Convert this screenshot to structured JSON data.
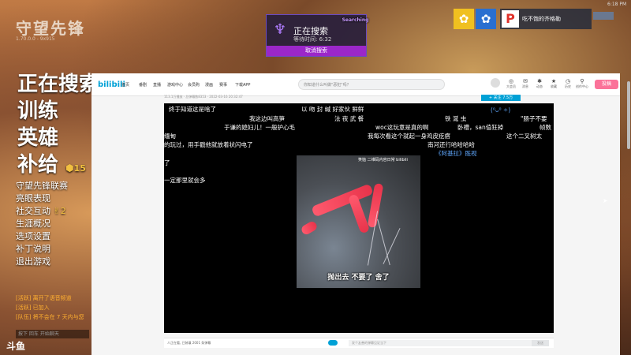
{
  "game": {
    "logo": "守望先锋",
    "version": "1.70.0.0 - 9x915",
    "menu_big": [
      "正在搜索",
      "训练",
      "英雄",
      "补给"
    ],
    "menu_small": [
      "守望先锋联赛",
      "亮眼表现",
      "社交互动",
      "生涯概况",
      "选项设置",
      "补丁说明",
      "退出游戏"
    ],
    "social_count": "2",
    "supply_count": "15",
    "chat": [
      "[活跃] 离开了语音频道",
      "[活跃] 已加入",
      "[队伍] 将不会在 7 天内与您"
    ],
    "chat_placeholder": "按下 回车 开始聊天",
    "corner": "斗鱼",
    "search_panel": {
      "subtitle": "Searching",
      "title": "正在搜索",
      "time": "等待时间: 6:32",
      "cancel": "取消搜索"
    },
    "profile": {
      "avatar": "P",
      "name": "吃不饱的齐格勒",
      "level": ""
    },
    "clock": "6:18 PM"
  },
  "browser": {
    "logo": "bilibili",
    "nav": [
      "首页",
      "番剧",
      "直播",
      "游戏中心",
      "会员购",
      "漫画",
      "赛事",
      "下载APP"
    ],
    "search_placeholder": "你知道什么叫做\"恶犯\"吗？",
    "right_icons": [
      {
        "icon": "◎",
        "label": "大会员"
      },
      {
        "icon": "✉",
        "label": "消息"
      },
      {
        "icon": "✱",
        "label": "动态"
      },
      {
        "icon": "★",
        "label": "收藏"
      },
      {
        "icon": "◷",
        "label": "历史"
      },
      {
        "icon": "⚲",
        "label": "创作中心"
      }
    ],
    "upload": "投稿",
    "meta": "113.1万播放 · 总弹幕数8353 · 2022-03-16 20:32:47",
    "follow": "+ 关注 7.5万",
    "danmaku": [
      {
        "text": "终于知道这是啥了",
        "color": "white"
      },
      {
        "text": "以 吻 封 缄  好家伙 鲜鲜",
        "color": "white"
      },
      {
        "text": "我这边叫高笋",
        "color": "white"
      },
      {
        "text": "法 夜 武 餐",
        "color": "white"
      },
      {
        "text": "铁 涎 虫",
        "color": "white"
      },
      {
        "text": "(⁰ᴗ⁰ ✧)",
        "color": "blue"
      },
      {
        "text": "\"肠子不要",
        "color": "white"
      },
      {
        "text": "于谦的媳妇儿！一般护心毛",
        "color": "white"
      },
      {
        "text": "woc这玩意是真的啊",
        "color": "white"
      },
      {
        "text": "卧槽，san值狂掉",
        "color": "white"
      },
      {
        "text": "帧数",
        "color": "white"
      },
      {
        "text": "我每次看这个就起一身鸡皮疙瘩",
        "color": "white"
      },
      {
        "text": "这个二叉树太",
        "color": "white"
      },
      {
        "text": "缅甸",
        "color": "white"
      },
      {
        "text": "的玩过，用手戳他就放着状闪电了",
        "color": "white"
      },
      {
        "text": "南河还行哈哈哈哈",
        "color": "white"
      },
      {
        "text": "《阿基拉》既视",
        "color": "blue"
      },
      {
        "text": "了",
        "color": "white"
      },
      {
        "text": "一定那里就会多",
        "color": "white"
      }
    ],
    "watermark": "笑恼 二维码内容日常 bilibili",
    "subtitle": "抛出去 不要了 舍了",
    "bottom_info": "人正在看, 已装填 2001 条弹幕",
    "dm_placeholder": "发个友善的弹幕见证当下",
    "dm_send": "发送"
  }
}
